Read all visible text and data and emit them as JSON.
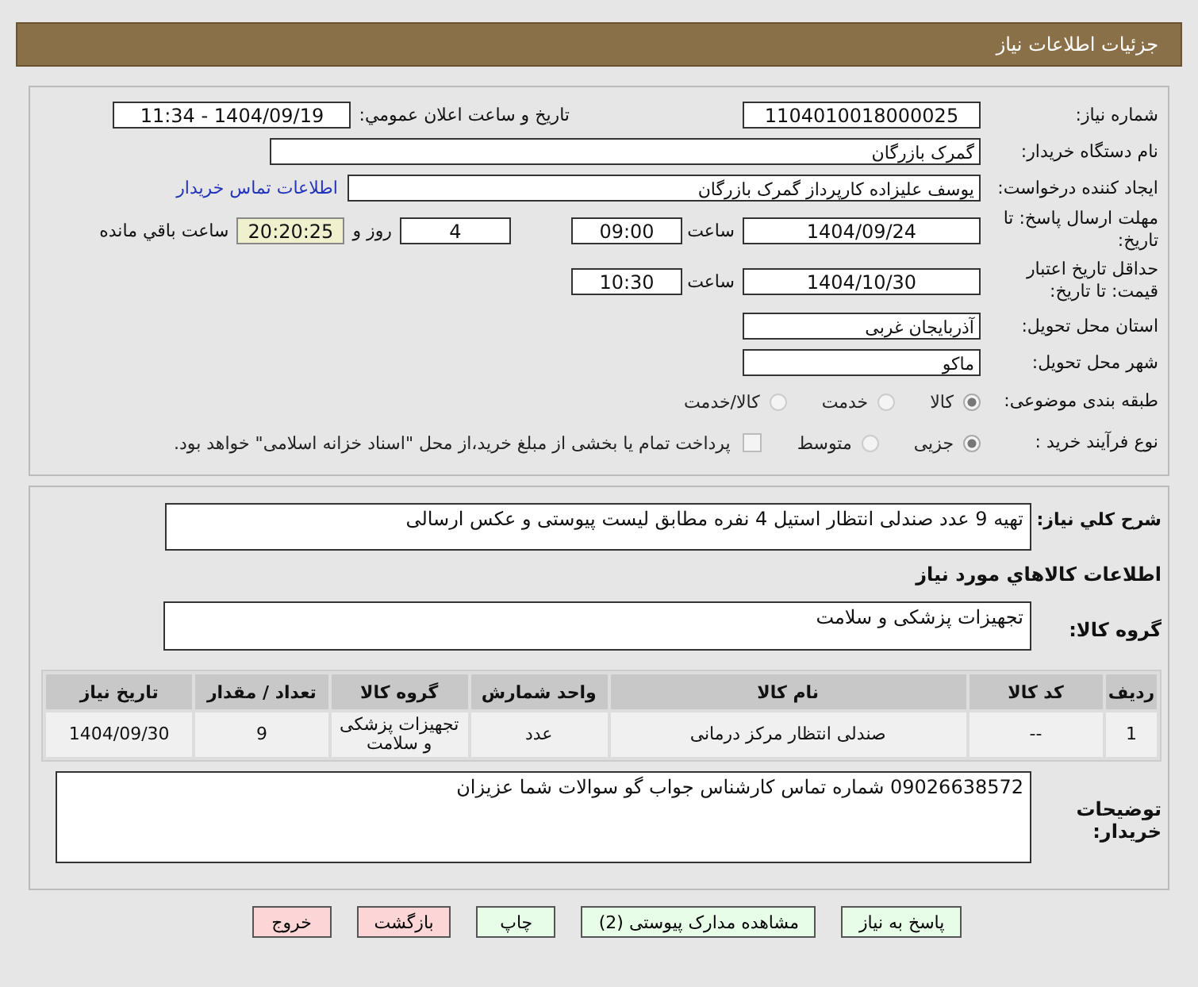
{
  "title": "جزئیات اطلاعات نیاز",
  "need_number": {
    "label": "شماره نیاز:",
    "value": "1104010018000025"
  },
  "announce": {
    "label": "تاریخ و ساعت اعلان عمومي:",
    "value": "1404/09/19 - 11:34"
  },
  "buyer": {
    "label": "نام دستگاه خریدار:",
    "value": "گمرک بازرگان"
  },
  "creator": {
    "label": "ایجاد کننده درخواست:",
    "value": "یوسف علیزاده کارپرداز گمرک بازرگان",
    "link": "اطلاعات تماس خریدار"
  },
  "reply_deadline": {
    "label": "مهلت ارسال پاسخ: تا تاریخ:",
    "date": "1404/09/24",
    "time_label": "ساعت",
    "time": "09:00",
    "days": "4",
    "days_label": "روز و",
    "remaining": "20:20:25",
    "remaining_label": "ساعت باقي مانده"
  },
  "price_validity": {
    "label": "حداقل تاریخ اعتبار قیمت: تا تاریخ:",
    "date": "1404/10/30",
    "time_label": "ساعت",
    "time": "10:30"
  },
  "province": {
    "label": "استان محل تحویل:",
    "value": "آذربایجان غربی"
  },
  "city": {
    "label": "شهر محل تحویل:",
    "value": "ماکو"
  },
  "category": {
    "label": "طبقه بندی موضوعی:",
    "options": [
      {
        "label": "کالا",
        "selected": true
      },
      {
        "label": "خدمت",
        "selected": false
      },
      {
        "label": "کالا/خدمت",
        "selected": false
      }
    ]
  },
  "process": {
    "label": "نوع فرآیند خرید :",
    "options": [
      {
        "label": "جزیی",
        "selected": true
      },
      {
        "label": "متوسط",
        "selected": false
      }
    ],
    "payment": {
      "label": "پرداخت تمام یا بخشی از مبلغ خرید،از محل \"اسناد خزانه اسلامی\" خواهد بود.",
      "checked": false
    }
  },
  "description": {
    "label": "شرح کلي نياز:",
    "value": "تهیه 9 عدد صندلی انتظار استیل 4 نفره مطابق لیست پیوستی و عکس ارسالی"
  },
  "goods_heading": "اطلاعات کالاهاي مورد نياز",
  "goods_group": {
    "label": "گروه کالا:",
    "value": "تجهیزات پزشکی و سلامت"
  },
  "table": {
    "columns": [
      "ردیف",
      "کد کالا",
      "نام کالا",
      "واحد شمارش",
      "گروه کالا",
      "تعداد / مقدار",
      "تاریخ نیاز"
    ],
    "rows": [
      [
        "1",
        "--",
        "صندلی انتظار مرکز درمانی",
        "عدد",
        "تجهیزات پزشکی و سلامت",
        "9",
        "1404/09/30"
      ]
    ]
  },
  "notes": {
    "label": "توضیحات خریدار:",
    "value": "09026638572 شماره تماس کارشناس جواب گو سوالات شما عزیزان"
  },
  "buttons": [
    {
      "label": "پاسخ به نیاز",
      "kind": "action"
    },
    {
      "label": "مشاهده مدارک پیوستی (2)",
      "kind": "action"
    },
    {
      "label": "چاپ",
      "kind": "action"
    },
    {
      "label": "بازگشت",
      "kind": "exit"
    },
    {
      "label": "خروج",
      "kind": "exit"
    }
  ]
}
